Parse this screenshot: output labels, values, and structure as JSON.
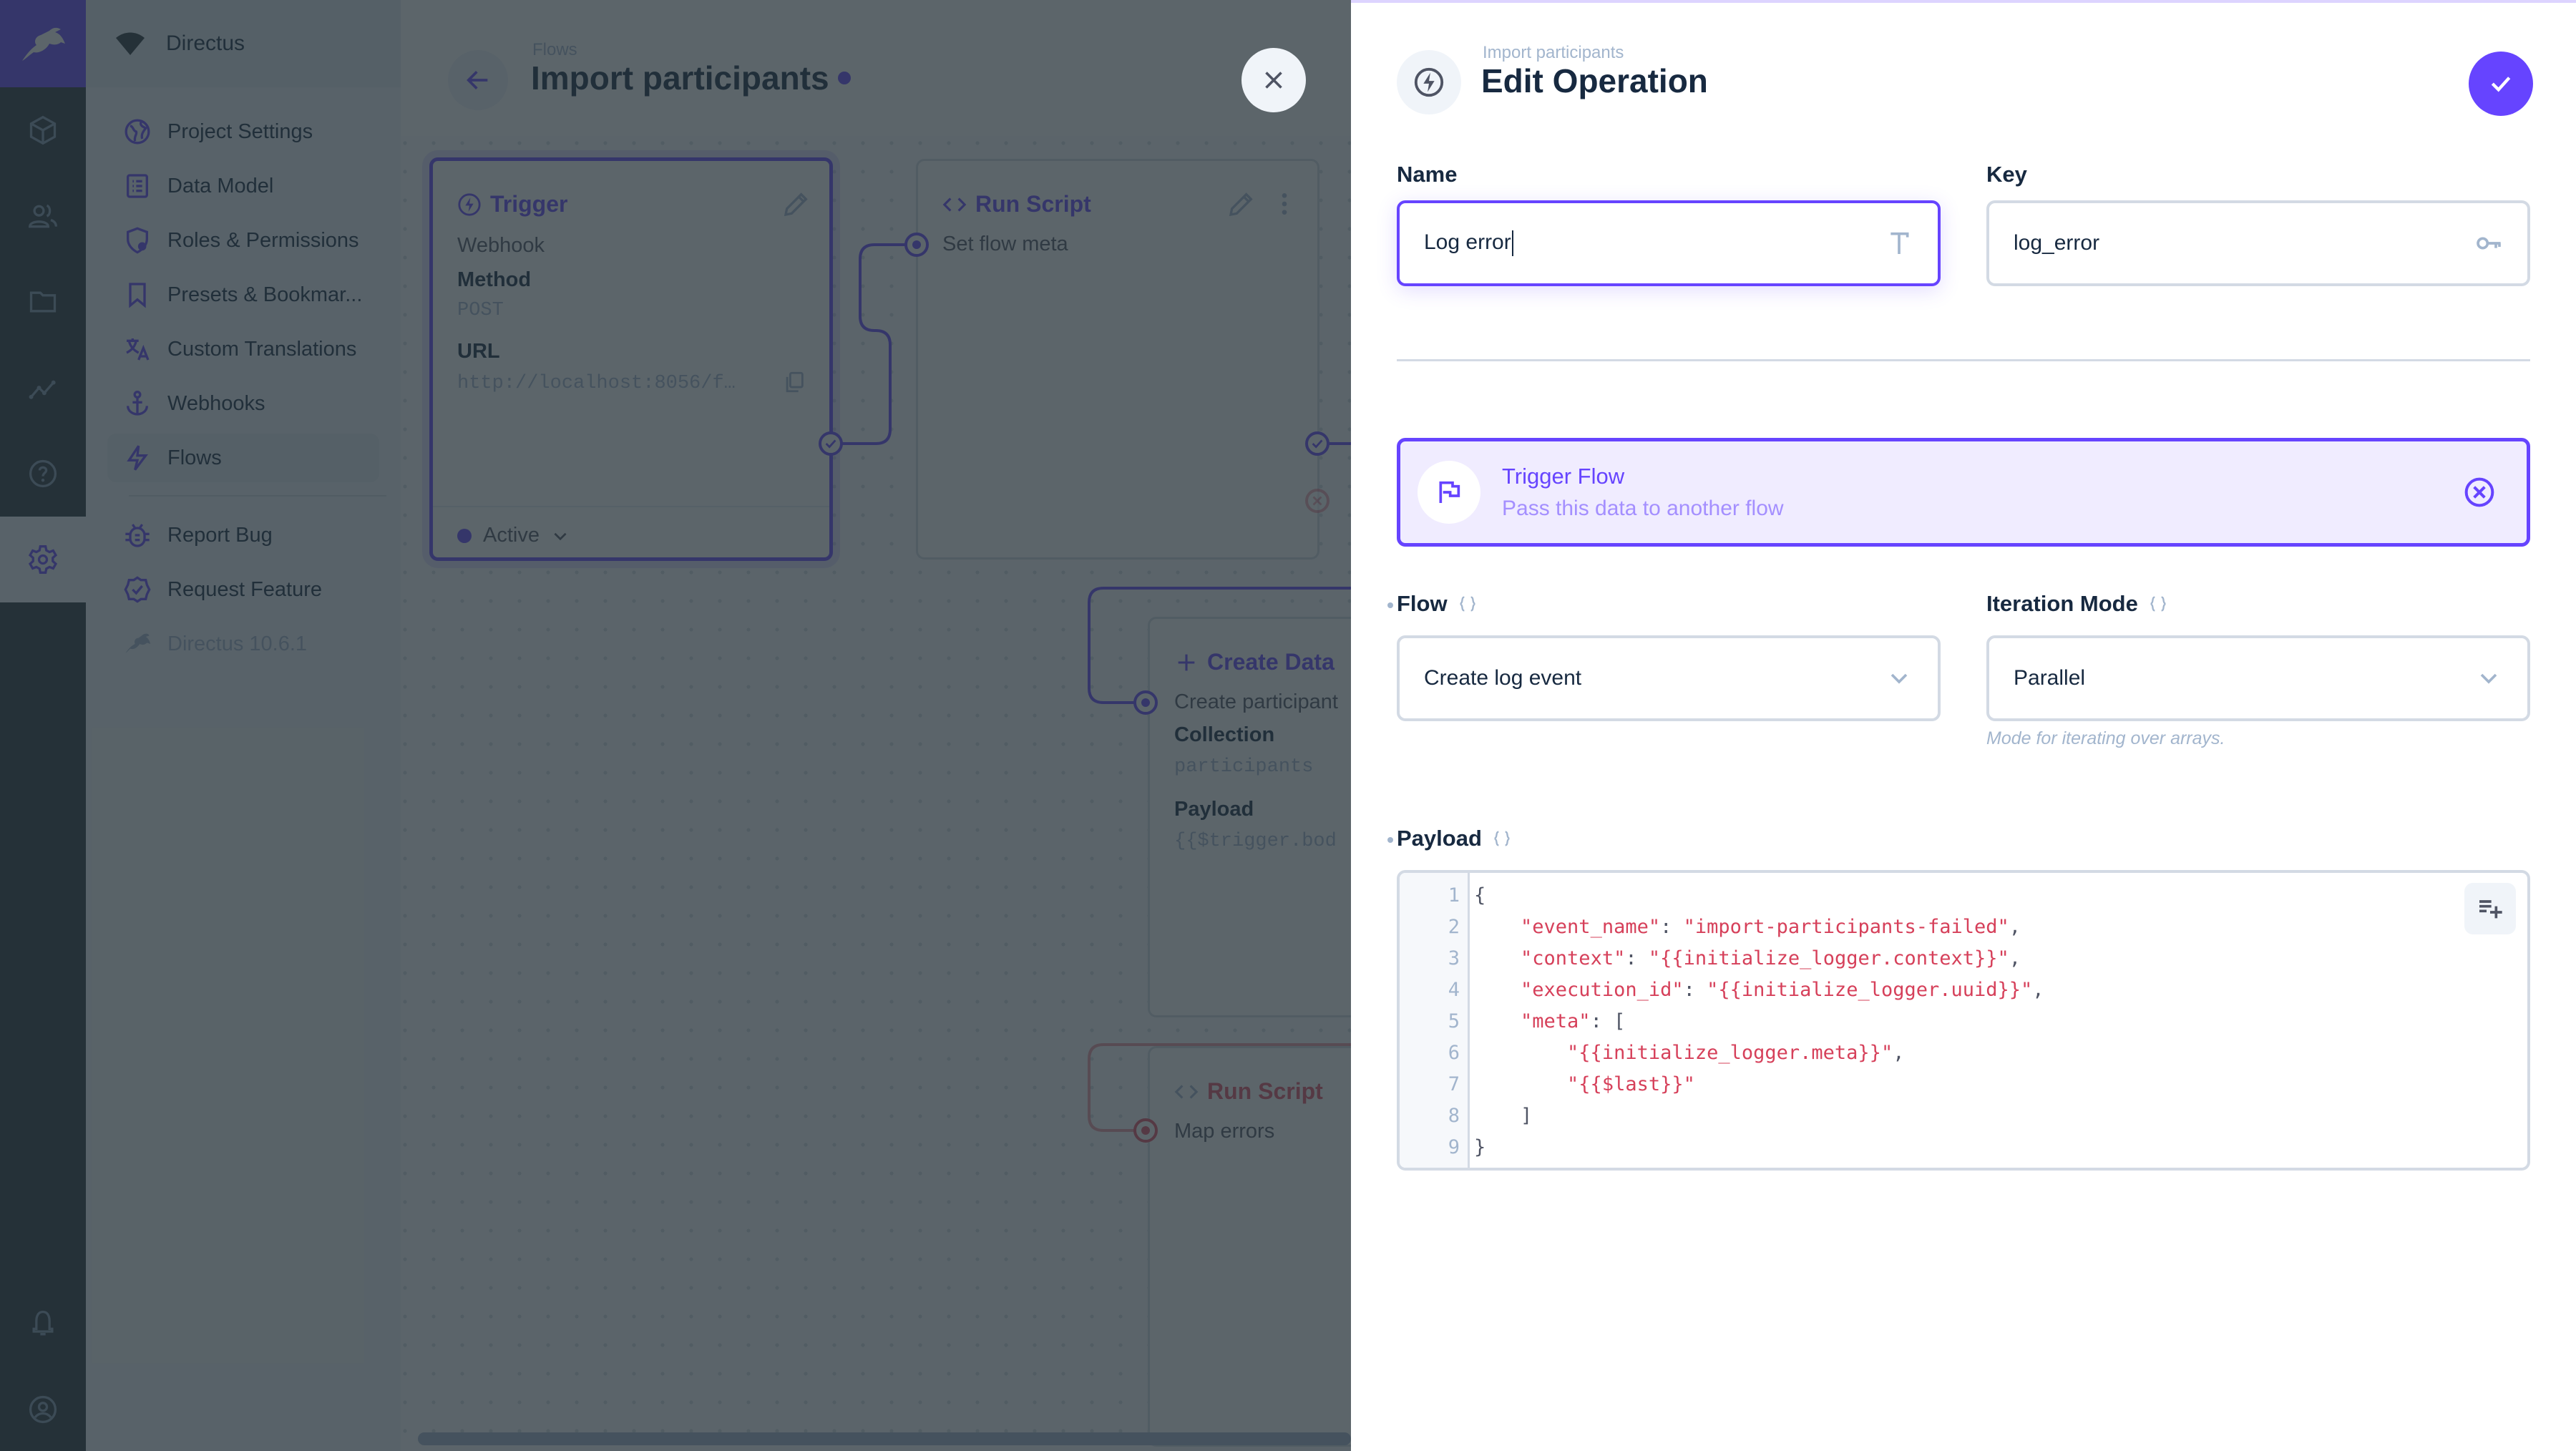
{
  "app": {
    "project_name": "Directus",
    "version_label": "Directus 10.6.1"
  },
  "module_bar": {
    "items": [
      {
        "icon": "content-box-icon",
        "label": "Content"
      },
      {
        "icon": "users-icon",
        "label": "User Directory"
      },
      {
        "icon": "folder-icon",
        "label": "File Library"
      },
      {
        "icon": "insights-icon",
        "label": "Insights"
      },
      {
        "icon": "help-icon",
        "label": "Documentation"
      },
      {
        "icon": "gear-icon",
        "label": "Settings",
        "active": true
      }
    ],
    "bottom": [
      {
        "icon": "bell-icon",
        "label": "Notifications"
      },
      {
        "icon": "account-icon",
        "label": "User"
      }
    ]
  },
  "settings_nav": {
    "items": [
      {
        "label": "Project Settings",
        "icon": "globe-icon"
      },
      {
        "label": "Data Model",
        "icon": "list-icon"
      },
      {
        "label": "Roles & Permissions",
        "icon": "shield-icon"
      },
      {
        "label": "Presets & Bookmar...",
        "icon": "bookmark-icon"
      },
      {
        "label": "Custom Translations",
        "icon": "translate-icon"
      },
      {
        "label": "Webhooks",
        "icon": "anchor-icon"
      },
      {
        "label": "Flows",
        "icon": "bolt-icon",
        "active": true
      }
    ],
    "secondary": [
      {
        "label": "Report Bug",
        "icon": "bug-icon"
      },
      {
        "label": "Request Feature",
        "icon": "verified-icon"
      }
    ]
  },
  "flow_header": {
    "breadcrumb": "Flows",
    "title": "Import participants"
  },
  "flow_canvas": {
    "trigger": {
      "title": "Trigger",
      "type": "Webhook",
      "method_label": "Method",
      "method_value": "POST",
      "url_label": "URL",
      "url_value": "http://localhost:8056/f…",
      "status": "Active"
    },
    "operations": [
      {
        "title": "Run Script",
        "name": "Set flow meta"
      },
      {
        "title": "Create Data",
        "name": "Create participant",
        "collection_label": "Collection",
        "collection_value": "participants",
        "payload_label": "Payload",
        "payload_value": "{{$trigger.bod"
      },
      {
        "title": "Run Script",
        "name": "Map errors"
      }
    ]
  },
  "drawer": {
    "breadcrumb": "Import participants",
    "title": "Edit Operation",
    "fields": {
      "name": {
        "label": "Name",
        "value": "Log error"
      },
      "key": {
        "label": "Key",
        "value": "log_error"
      },
      "operation_type": {
        "title": "Trigger Flow",
        "description": "Pass this data to another flow"
      },
      "flow": {
        "label": "Flow",
        "value": "Create log event"
      },
      "iteration_mode": {
        "label": "Iteration Mode",
        "value": "Parallel",
        "hint": "Mode for iterating over arrays."
      },
      "payload": {
        "label": "Payload",
        "lines": [
          "{",
          "    \"event_name\": \"import-participants-failed\",",
          "    \"context\": \"{{initialize_logger.context}}\",",
          "    \"execution_id\": \"{{initialize_logger.uuid}}\",",
          "    \"meta\": [",
          "        \"{{initialize_logger.meta}}\",",
          "        \"{{$last}}\"",
          "    ]",
          "}"
        ]
      }
    }
  },
  "colors": {
    "primary": "#6644ff",
    "danger": "#e35169",
    "module_bar": "#263238",
    "code_string": "#d6405a"
  }
}
